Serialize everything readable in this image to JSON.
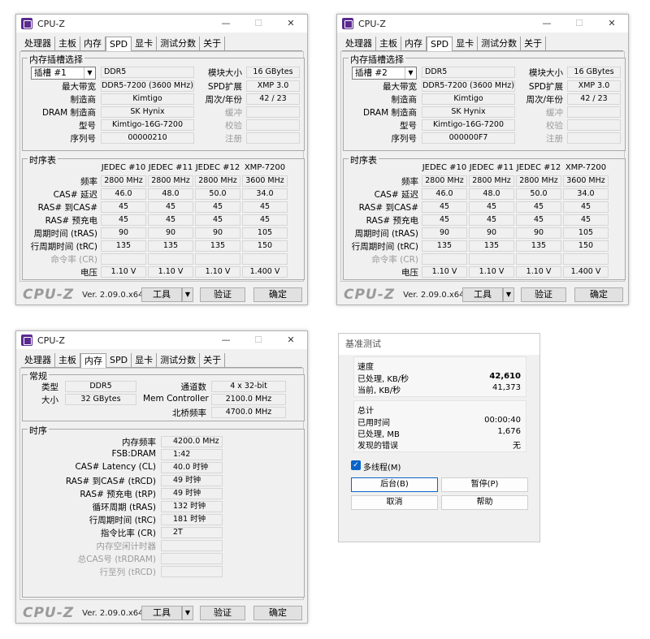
{
  "app_title": "CPU-Z",
  "tabs": [
    "处理器",
    "主板",
    "内存",
    "SPD",
    "显卡",
    "测试分数",
    "关于"
  ],
  "bottom": {
    "logo": "CPU-Z",
    "version": "Ver. 2.09.0.x64",
    "tools": "工具",
    "validate": "验证",
    "ok": "确定"
  },
  "win_controls": {
    "min": "—",
    "max": "☐",
    "close": "✕"
  },
  "spd_labels": {
    "group_slot": "内存插槽选择",
    "max_bw": "最大带宽",
    "manufacturer": "制造商",
    "dram_mfr": "DRAM 制造商",
    "part": "型号",
    "serial": "序列号",
    "module_size": "模块大小",
    "spd_ext": "SPD扩展",
    "week_year": "周次/年份",
    "buffered": "缓冲",
    "correction": "校验",
    "registered": "注册",
    "group_timings": "时序表",
    "freq": "频率",
    "cas": "CAS# 延迟",
    "ras_cas": "RAS# 到CAS#",
    "ras_pre": "RAS# 预充电",
    "tras": "周期时间 (tRAS)",
    "trc": "行周期时间 (tRC)",
    "cr": "命令率 (CR)",
    "voltage": "电压",
    "cols": [
      "JEDEC #10",
      "JEDEC #11",
      "JEDEC #12",
      "XMP-7200"
    ]
  },
  "spd1": {
    "slot": "插槽 #1",
    "type": "DDR5",
    "max_bw": "DDR5-7200 (3600 MHz)",
    "manufacturer": "Kimtigo",
    "dram_mfr": "SK Hynix",
    "part": "Kimtigo-16G-7200",
    "serial": "00000210",
    "module_size": "16 GBytes",
    "spd_ext": "XMP 3.0",
    "week_year": "42 / 23",
    "freq": [
      "2800 MHz",
      "2800 MHz",
      "2800 MHz",
      "3600 MHz"
    ],
    "cas": [
      "46.0",
      "48.0",
      "50.0",
      "34.0"
    ],
    "ras_cas": [
      "45",
      "45",
      "45",
      "45"
    ],
    "ras_pre": [
      "45",
      "45",
      "45",
      "45"
    ],
    "tras": [
      "90",
      "90",
      "90",
      "105"
    ],
    "trc": [
      "135",
      "135",
      "135",
      "150"
    ],
    "voltage": [
      "1.10 V",
      "1.10 V",
      "1.10 V",
      "1.400 V"
    ]
  },
  "spd2": {
    "slot": "插槽 #2",
    "type": "DDR5",
    "max_bw": "DDR5-7200 (3600 MHz)",
    "manufacturer": "Kimtigo",
    "dram_mfr": "SK Hynix",
    "part": "Kimtigo-16G-7200",
    "serial": "000000F7",
    "module_size": "16 GBytes",
    "spd_ext": "XMP 3.0",
    "week_year": "42 / 23",
    "freq": [
      "2800 MHz",
      "2800 MHz",
      "2800 MHz",
      "3600 MHz"
    ],
    "cas": [
      "46.0",
      "48.0",
      "50.0",
      "34.0"
    ],
    "ras_cas": [
      "45",
      "45",
      "45",
      "45"
    ],
    "ras_pre": [
      "45",
      "45",
      "45",
      "45"
    ],
    "tras": [
      "90",
      "90",
      "90",
      "105"
    ],
    "trc": [
      "135",
      "135",
      "135",
      "150"
    ],
    "voltage": [
      "1.10 V",
      "1.10 V",
      "1.10 V",
      "1.400 V"
    ]
  },
  "mem": {
    "group_general": "常规",
    "type_lbl": "类型",
    "type": "DDR5",
    "size_lbl": "大小",
    "size": "32 GBytes",
    "channels_lbl": "通道数",
    "channels": "4 x 32-bit",
    "mc_lbl": "Mem Controller",
    "mc": "2100.0 MHz",
    "nb_lbl": "北桥频率",
    "nb": "4700.0 MHz",
    "group_timing": "时序",
    "rows": [
      {
        "label": "内存频率",
        "value": "4200.0 MHz",
        "dis": false
      },
      {
        "label": "FSB:DRAM",
        "value": "1:42",
        "dis": false
      },
      {
        "label": "CAS# Latency (CL)",
        "value": "40.0 时钟",
        "dis": false
      },
      {
        "label": "RAS# 到CAS# (tRCD)",
        "value": "49 时钟",
        "dis": false
      },
      {
        "label": "RAS# 预充电 (tRP)",
        "value": "49 时钟",
        "dis": false
      },
      {
        "label": "循环周期 (tRAS)",
        "value": "132 时钟",
        "dis": false
      },
      {
        "label": "行周期时间 (tRC)",
        "value": "181 时钟",
        "dis": false
      },
      {
        "label": "指令比率 (CR)",
        "value": "2T",
        "dis": false
      },
      {
        "label": "内存空闲计时器",
        "value": "",
        "dis": true
      },
      {
        "label": "总CAS号 (tRDRAM)",
        "value": "",
        "dis": true
      },
      {
        "label": "行至列 (tRCD)",
        "value": "",
        "dis": true
      }
    ]
  },
  "bench": {
    "title": "基准测试",
    "speed_grp": "速度",
    "processed_lbl": "已处理, KB/秒",
    "processed": "42,610",
    "current_lbl": "当前, KB/秒",
    "current": "41,373",
    "total_grp": "总计",
    "elapsed_lbl": "已用时间",
    "elapsed": "00:00:40",
    "mb_lbl": "已处理, MB",
    "mb": "1,676",
    "errors_lbl": "发现的错误",
    "errors": "无",
    "multithread": "多线程(M)",
    "background": "后台(B)",
    "pause": "暂停(P)",
    "cancel": "取消",
    "help": "帮助"
  }
}
